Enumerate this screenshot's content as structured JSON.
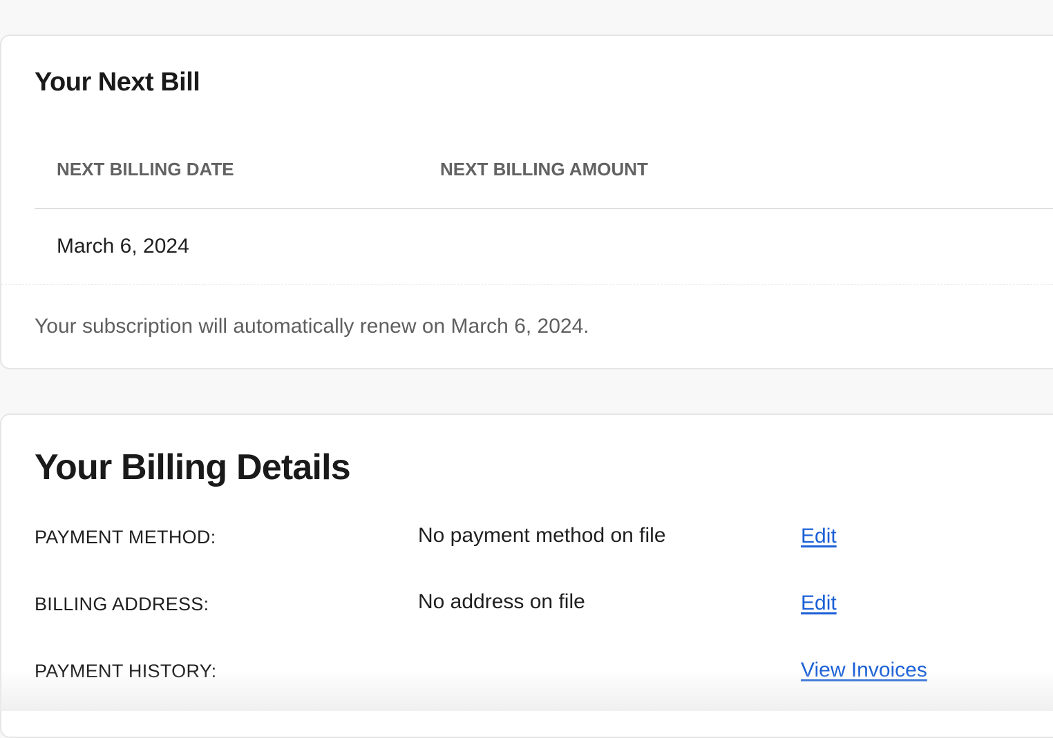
{
  "next_bill": {
    "title": "Your Next Bill",
    "columns": {
      "date_header": "NEXT BILLING DATE",
      "amount_header": "NEXT BILLING AMOUNT"
    },
    "date_value": "March 6, 2024",
    "amount_value": "",
    "renewal_note": "Your subscription will automatically renew on March 6, 2024."
  },
  "billing_details": {
    "title": "Your Billing Details",
    "rows": [
      {
        "label": "PAYMENT METHOD:",
        "value": "No payment method on file",
        "action": "Edit"
      },
      {
        "label": "BILLING ADDRESS:",
        "value": "No address on file",
        "action": "Edit"
      },
      {
        "label": "PAYMENT HISTORY:",
        "value": "",
        "action": "View Invoices"
      }
    ]
  },
  "colors": {
    "link": "#1a5fd6",
    "page_background": "#f8f8f8",
    "card_border": "#e5e5e5"
  }
}
